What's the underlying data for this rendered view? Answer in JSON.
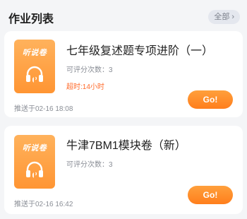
{
  "header": {
    "title": "作业列表",
    "see_all_label": "全部",
    "see_all_icon": "chevron-right-icon"
  },
  "assignments": [
    {
      "cover_label": "听说卷",
      "cover_icon": "headphones-icon",
      "title": "七年级复述题专项进阶（一）",
      "count_text": "可评分次数：3",
      "overdue_text": "超时:14小时",
      "pushed_text": "推送于02-16 18:08",
      "button_label": "Go!"
    },
    {
      "cover_label": "听说卷",
      "cover_icon": "headphones-icon",
      "title": "牛津7BM1模块卷（新）",
      "count_text": "可评分次数：3",
      "pushed_text": "推送于02-16 16:42",
      "button_label": "Go!"
    }
  ],
  "colors": {
    "accent": "#ff8a2a",
    "overdue": "#ff6a2a",
    "background": "#f4f5f7"
  }
}
